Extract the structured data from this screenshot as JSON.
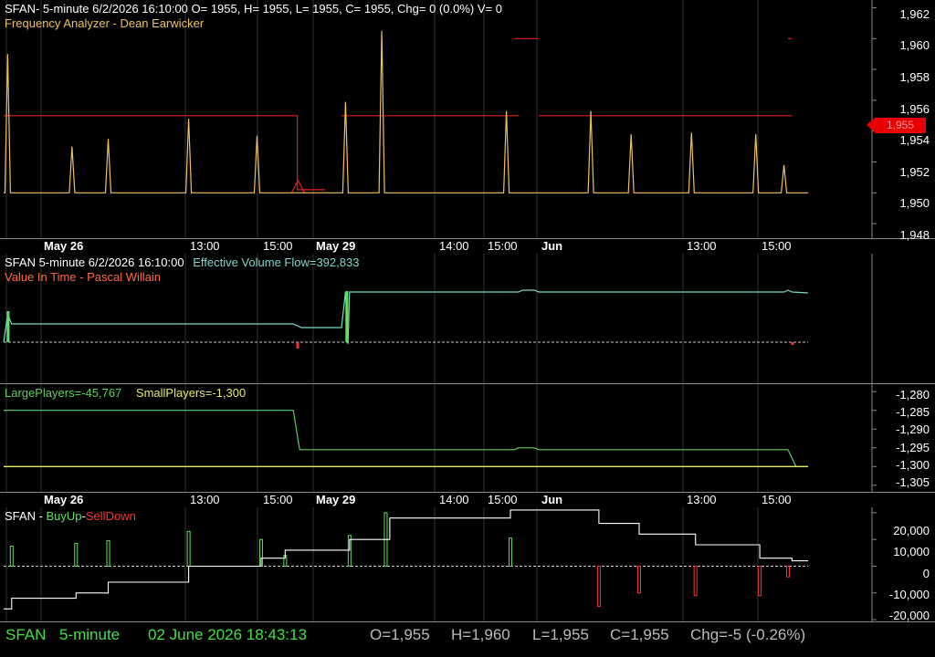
{
  "colors": {
    "background": "#000000",
    "grid": "#555555",
    "price": "#f0c060",
    "freq": "#e02020",
    "evf": "#7fd8c8",
    "large": "#5fcf5f",
    "small": "#e8e86a",
    "buy": "#60e060",
    "sell": "#ff3030",
    "cum": "#ffffff",
    "status_green": "#40e040"
  },
  "panel1": {
    "header_line1": "SFAN- 5-minute 6/2/2026 16:10:00 O= 1955, H= 1955, L= 1955, C= 1955, Chg= 0 (0.0%) V= 0",
    "header_line2": "Frequency Analyzer - Dean Earwicker",
    "axis_ticks": [
      "1,962",
      "1,960",
      "1,958",
      "1,956",
      "1,954",
      "1,952",
      "1,950",
      "1,948"
    ],
    "last_price_tag": "1,955"
  },
  "date_axis": {
    "labels": [
      {
        "text": "May 26",
        "bold": true
      },
      {
        "text": "13:00",
        "bold": false
      },
      {
        "text": "15:00",
        "bold": false
      },
      {
        "text": "May 29",
        "bold": true
      },
      {
        "text": "14:00",
        "bold": false
      },
      {
        "text": "15:00",
        "bold": false
      },
      {
        "text": "Jun",
        "bold": true
      },
      {
        "text": "13:00",
        "bold": false
      },
      {
        "text": "15:00",
        "bold": false
      }
    ]
  },
  "panel2": {
    "header_symbol": "SFAN 5-minute  6/2/2026 16:10:00",
    "header_evf": "Effective Volume Flow=392,833",
    "header_line2": "Value In Time - Pascal Willain"
  },
  "panel3": {
    "large_label": "LargePlayers=-45,767",
    "small_label": "SmallPlayers=-1,300",
    "axis_ticks": [
      "-1,280",
      "-1,285",
      "-1,290",
      "-1,295",
      "-1,300",
      "-1,305"
    ]
  },
  "panel4": {
    "header_prefix": "SFAN - ",
    "buy_label": "BuyUp",
    "dash": "-",
    "sell_label": "SellDown",
    "axis_ticks": [
      "20,000",
      "10,000",
      "0",
      "-10,000",
      "-20,000"
    ]
  },
  "status": {
    "symbol": "SFAN",
    "interval": "5-minute",
    "datetime": "02 June 2026 18:43:13",
    "open": "O=1,955",
    "high": "H=1,960",
    "low": "L=1,955",
    "close": "C=1,955",
    "change": "Chg=-5 (-0.26%)"
  },
  "chart_data": [
    {
      "type": "line",
      "title": "Frequency Analyzer - Dean Earwicker",
      "x": [
        0,
        4,
        8,
        12,
        16,
        20,
        24,
        28,
        32,
        36,
        40,
        44,
        48,
        52,
        56,
        60,
        64,
        68,
        72,
        76,
        80,
        84,
        88,
        92,
        96,
        100
      ],
      "series": [
        {
          "name": "SFAN",
          "values": [
            1950,
            1959,
            1950,
            1950,
            1953,
            1950,
            1953.5,
            1950,
            1954.8,
            1950,
            1953.7,
            1950,
            1955.9,
            1960.5,
            1950,
            1950,
            1955.3,
            1950,
            1955.3,
            1950,
            1953.8,
            1950,
            1953.9,
            1950,
            1951.8,
            1950
          ]
        }
      ],
      "ylim": [
        1947,
        1962.5
      ],
      "last_price": 1955
    },
    {
      "type": "line",
      "title": "Value In Time - Pascal Willain",
      "series": [
        {
          "name": "Effective Volume Flow",
          "values": [
            0,
            20000,
            20000,
            20000,
            20000,
            20000,
            20000,
            20000,
            18000,
            18000,
            392833,
            392833,
            392833,
            392833,
            393500,
            393500,
            392833,
            392833,
            392833,
            392833,
            392833,
            392833,
            392833,
            392833,
            393000,
            392833
          ]
        }
      ]
    },
    {
      "type": "line",
      "series": [
        {
          "name": "LargePlayers",
          "values": [
            -1285,
            -1285,
            -1285,
            -1285,
            -1285,
            -1285,
            -1285,
            -1285,
            -1285,
            -1295.5,
            -1295.5,
            -1295.5,
            -1295.5,
            -1295.5,
            -1295.5,
            -1295,
            -1295.5,
            -1295.5,
            -1295.5,
            -1295.5,
            -1295.5,
            -1295.5,
            -1295.5,
            -1295.5,
            -1295.5,
            -1300
          ]
        },
        {
          "name": "SmallPlayers",
          "values": [
            -1300,
            -1300,
            -1300,
            -1300,
            -1300,
            -1300,
            -1300,
            -1300,
            -1300,
            -1300,
            -1300,
            -1300,
            -1300,
            -1300,
            -1300,
            -1300,
            -1300,
            -1300,
            -1300,
            -1300,
            -1300,
            -1300,
            -1300,
            -1300,
            -1300,
            -1300
          ]
        }
      ],
      "ylim": [
        -1307,
        -1278
      ]
    },
    {
      "type": "bar",
      "ylim": [
        -21000,
        22000
      ],
      "bars": [
        {
          "x": 1,
          "value": 7500,
          "series": "BuyUp"
        },
        {
          "x": 9,
          "value": 8500,
          "series": "BuyUp"
        },
        {
          "x": 13,
          "value": 9500,
          "series": "BuyUp"
        },
        {
          "x": 23,
          "value": 13000,
          "series": "BuyUp"
        },
        {
          "x": 32,
          "value": 10000,
          "series": "BuyUp"
        },
        {
          "x": 35,
          "value": 4000,
          "series": "BuyUp"
        },
        {
          "x": 43,
          "value": 11500,
          "series": "BuyUp"
        },
        {
          "x": 47.5,
          "value": 20000,
          "series": "BuyUp"
        },
        {
          "x": 63,
          "value": 10500,
          "series": "BuyUp"
        },
        {
          "x": 74,
          "value": -15000,
          "series": "SellDown"
        },
        {
          "x": 79,
          "value": -10000,
          "series": "SellDown"
        },
        {
          "x": 86,
          "value": -11000,
          "series": "SellDown"
        },
        {
          "x": 94,
          "value": -11000,
          "series": "SellDown"
        },
        {
          "x": 97.5,
          "value": -4000,
          "series": "SellDown"
        }
      ],
      "cumulative": {
        "x": [
          0,
          1,
          8,
          9,
          12,
          13,
          22,
          23,
          31,
          32,
          34,
          35,
          42,
          43,
          47,
          48,
          62,
          63,
          73,
          74,
          78,
          79,
          85,
          86,
          93,
          94,
          97,
          98,
          100
        ],
        "values": [
          -16000,
          -12000,
          -12000,
          -10000,
          -10000,
          -6000,
          -6000,
          0,
          0,
          3000,
          3000,
          6000,
          6000,
          10000,
          10000,
          18000,
          18000,
          21000,
          21000,
          16000,
          16000,
          12000,
          12000,
          8000,
          8000,
          3000,
          3000,
          2000,
          2000
        ]
      }
    }
  ]
}
